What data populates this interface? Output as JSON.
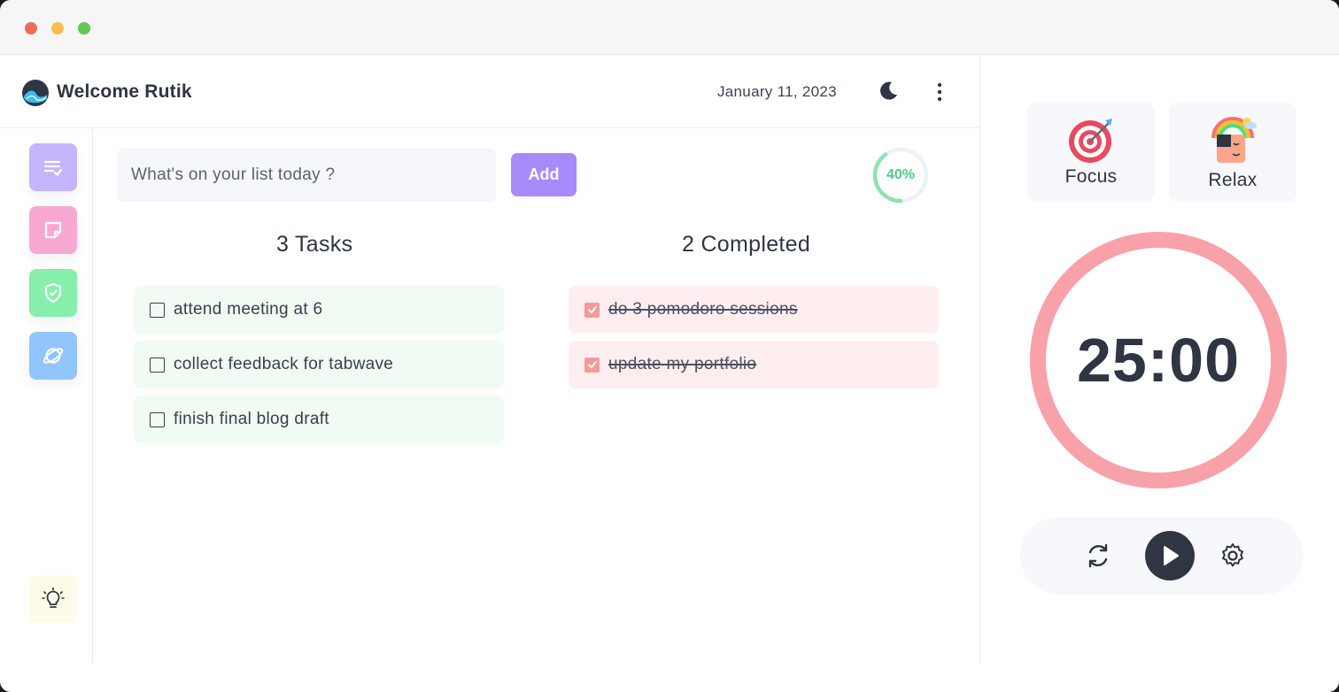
{
  "header": {
    "welcome": "Welcome Rutik",
    "date": "January 11, 2023",
    "icons": [
      "logo-icon",
      "moon-icon",
      "more-vertical-icon"
    ]
  },
  "sidebar": {
    "items": [
      {
        "name": "tasks",
        "icon": "checklist-icon",
        "color": "#c4b5fd"
      },
      {
        "name": "notes",
        "icon": "sticky-note-icon",
        "color": "#f9a8d4"
      },
      {
        "name": "blocker",
        "icon": "shield-check-icon",
        "color": "#86efac"
      },
      {
        "name": "explore",
        "icon": "planet-icon",
        "color": "#93c5fd"
      }
    ],
    "bottom": {
      "name": "tips",
      "icon": "lightbulb-icon",
      "color": "#fefce8"
    }
  },
  "input": {
    "placeholder": "What's on your list today ?",
    "value": ""
  },
  "add_button": "Add",
  "progress": {
    "label": "40%",
    "value": 0.4,
    "color": "#4ecb86"
  },
  "tasks": {
    "title": "3 Tasks",
    "items": [
      {
        "text": "attend meeting at 6",
        "done": false
      },
      {
        "text": "collect feedback for tabwave",
        "done": false
      },
      {
        "text": "finish final blog draft",
        "done": false
      }
    ]
  },
  "completed": {
    "title": "2 Completed",
    "items": [
      {
        "text": "do 3 pomodoro sessions",
        "done": true
      },
      {
        "text": "update my portfolio",
        "done": true
      }
    ]
  },
  "modes": [
    {
      "label": "Focus",
      "icon": "target-icon"
    },
    {
      "label": "Relax",
      "icon": "relax-face-icon"
    }
  ],
  "timer": {
    "time": "25:00",
    "ring_color": "#f8a1a8"
  },
  "controls": [
    "reset-icon",
    "play-icon",
    "settings-icon"
  ]
}
